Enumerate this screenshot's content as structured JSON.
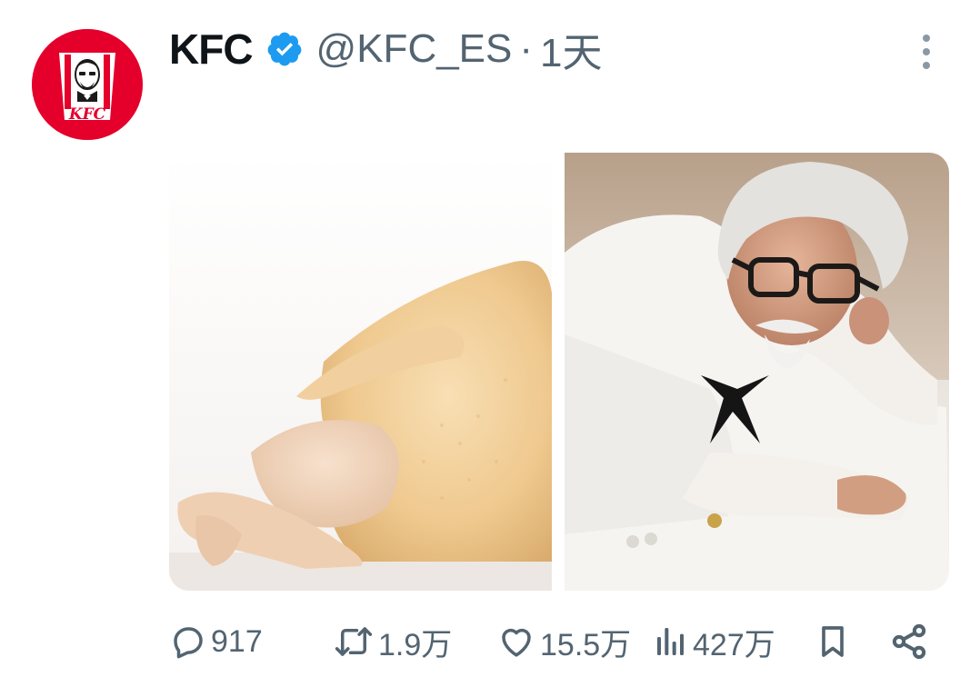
{
  "post": {
    "display_name": "KFC",
    "handle": "@KFC_ES",
    "separator": "·",
    "time": "1天",
    "avatar_logo_text": "KFC"
  },
  "media": {
    "left_image": "raw whole chicken on white background",
    "right_image": "man in white suit with glasses lying on floor"
  },
  "actions": {
    "replies": "917",
    "reposts": "1.9万",
    "likes": "15.5万",
    "views": "427万"
  },
  "colors": {
    "brand_red": "#e4002b",
    "verified_blue": "#1d9bf0",
    "muted_text": "#536471"
  },
  "icons": {
    "reply": "speech-bubble-icon",
    "repost": "repost-arrows-icon",
    "like": "heart-icon",
    "views": "bar-chart-icon",
    "bookmark": "bookmark-icon",
    "share": "share-icon",
    "more": "more-vertical-icon",
    "verified": "verified-badge-icon"
  }
}
